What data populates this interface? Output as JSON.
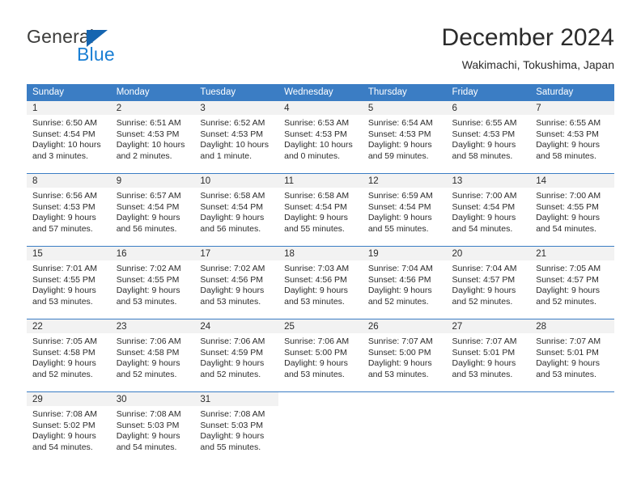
{
  "brand": {
    "name_top": "General",
    "name_bottom": "Blue",
    "triangle_color": "#1565b0",
    "blue_color": "#1a7fd4"
  },
  "header": {
    "title": "December 2024",
    "subtitle": "Wakimachi, Tokushima, Japan"
  },
  "theme": {
    "header_blue": "#3b7dc4",
    "daynum_gray": "#f2f2f2",
    "text": "#2b2b2b"
  },
  "weekday_headers": [
    "Sunday",
    "Monday",
    "Tuesday",
    "Wednesday",
    "Thursday",
    "Friday",
    "Saturday"
  ],
  "weeks": [
    [
      {
        "day": "1",
        "sunrise": "Sunrise: 6:50 AM",
        "sunset": "Sunset: 4:54 PM",
        "daylight1": "Daylight: 10 hours",
        "daylight2": "and 3 minutes."
      },
      {
        "day": "2",
        "sunrise": "Sunrise: 6:51 AM",
        "sunset": "Sunset: 4:53 PM",
        "daylight1": "Daylight: 10 hours",
        "daylight2": "and 2 minutes."
      },
      {
        "day": "3",
        "sunrise": "Sunrise: 6:52 AM",
        "sunset": "Sunset: 4:53 PM",
        "daylight1": "Daylight: 10 hours",
        "daylight2": "and 1 minute."
      },
      {
        "day": "4",
        "sunrise": "Sunrise: 6:53 AM",
        "sunset": "Sunset: 4:53 PM",
        "daylight1": "Daylight: 10 hours",
        "daylight2": "and 0 minutes."
      },
      {
        "day": "5",
        "sunrise": "Sunrise: 6:54 AM",
        "sunset": "Sunset: 4:53 PM",
        "daylight1": "Daylight: 9 hours",
        "daylight2": "and 59 minutes."
      },
      {
        "day": "6",
        "sunrise": "Sunrise: 6:55 AM",
        "sunset": "Sunset: 4:53 PM",
        "daylight1": "Daylight: 9 hours",
        "daylight2": "and 58 minutes."
      },
      {
        "day": "7",
        "sunrise": "Sunrise: 6:55 AM",
        "sunset": "Sunset: 4:53 PM",
        "daylight1": "Daylight: 9 hours",
        "daylight2": "and 58 minutes."
      }
    ],
    [
      {
        "day": "8",
        "sunrise": "Sunrise: 6:56 AM",
        "sunset": "Sunset: 4:53 PM",
        "daylight1": "Daylight: 9 hours",
        "daylight2": "and 57 minutes."
      },
      {
        "day": "9",
        "sunrise": "Sunrise: 6:57 AM",
        "sunset": "Sunset: 4:54 PM",
        "daylight1": "Daylight: 9 hours",
        "daylight2": "and 56 minutes."
      },
      {
        "day": "10",
        "sunrise": "Sunrise: 6:58 AM",
        "sunset": "Sunset: 4:54 PM",
        "daylight1": "Daylight: 9 hours",
        "daylight2": "and 56 minutes."
      },
      {
        "day": "11",
        "sunrise": "Sunrise: 6:58 AM",
        "sunset": "Sunset: 4:54 PM",
        "daylight1": "Daylight: 9 hours",
        "daylight2": "and 55 minutes."
      },
      {
        "day": "12",
        "sunrise": "Sunrise: 6:59 AM",
        "sunset": "Sunset: 4:54 PM",
        "daylight1": "Daylight: 9 hours",
        "daylight2": "and 55 minutes."
      },
      {
        "day": "13",
        "sunrise": "Sunrise: 7:00 AM",
        "sunset": "Sunset: 4:54 PM",
        "daylight1": "Daylight: 9 hours",
        "daylight2": "and 54 minutes."
      },
      {
        "day": "14",
        "sunrise": "Sunrise: 7:00 AM",
        "sunset": "Sunset: 4:55 PM",
        "daylight1": "Daylight: 9 hours",
        "daylight2": "and 54 minutes."
      }
    ],
    [
      {
        "day": "15",
        "sunrise": "Sunrise: 7:01 AM",
        "sunset": "Sunset: 4:55 PM",
        "daylight1": "Daylight: 9 hours",
        "daylight2": "and 53 minutes."
      },
      {
        "day": "16",
        "sunrise": "Sunrise: 7:02 AM",
        "sunset": "Sunset: 4:55 PM",
        "daylight1": "Daylight: 9 hours",
        "daylight2": "and 53 minutes."
      },
      {
        "day": "17",
        "sunrise": "Sunrise: 7:02 AM",
        "sunset": "Sunset: 4:56 PM",
        "daylight1": "Daylight: 9 hours",
        "daylight2": "and 53 minutes."
      },
      {
        "day": "18",
        "sunrise": "Sunrise: 7:03 AM",
        "sunset": "Sunset: 4:56 PM",
        "daylight1": "Daylight: 9 hours",
        "daylight2": "and 53 minutes."
      },
      {
        "day": "19",
        "sunrise": "Sunrise: 7:04 AM",
        "sunset": "Sunset: 4:56 PM",
        "daylight1": "Daylight: 9 hours",
        "daylight2": "and 52 minutes."
      },
      {
        "day": "20",
        "sunrise": "Sunrise: 7:04 AM",
        "sunset": "Sunset: 4:57 PM",
        "daylight1": "Daylight: 9 hours",
        "daylight2": "and 52 minutes."
      },
      {
        "day": "21",
        "sunrise": "Sunrise: 7:05 AM",
        "sunset": "Sunset: 4:57 PM",
        "daylight1": "Daylight: 9 hours",
        "daylight2": "and 52 minutes."
      }
    ],
    [
      {
        "day": "22",
        "sunrise": "Sunrise: 7:05 AM",
        "sunset": "Sunset: 4:58 PM",
        "daylight1": "Daylight: 9 hours",
        "daylight2": "and 52 minutes."
      },
      {
        "day": "23",
        "sunrise": "Sunrise: 7:06 AM",
        "sunset": "Sunset: 4:58 PM",
        "daylight1": "Daylight: 9 hours",
        "daylight2": "and 52 minutes."
      },
      {
        "day": "24",
        "sunrise": "Sunrise: 7:06 AM",
        "sunset": "Sunset: 4:59 PM",
        "daylight1": "Daylight: 9 hours",
        "daylight2": "and 52 minutes."
      },
      {
        "day": "25",
        "sunrise": "Sunrise: 7:06 AM",
        "sunset": "Sunset: 5:00 PM",
        "daylight1": "Daylight: 9 hours",
        "daylight2": "and 53 minutes."
      },
      {
        "day": "26",
        "sunrise": "Sunrise: 7:07 AM",
        "sunset": "Sunset: 5:00 PM",
        "daylight1": "Daylight: 9 hours",
        "daylight2": "and 53 minutes."
      },
      {
        "day": "27",
        "sunrise": "Sunrise: 7:07 AM",
        "sunset": "Sunset: 5:01 PM",
        "daylight1": "Daylight: 9 hours",
        "daylight2": "and 53 minutes."
      },
      {
        "day": "28",
        "sunrise": "Sunrise: 7:07 AM",
        "sunset": "Sunset: 5:01 PM",
        "daylight1": "Daylight: 9 hours",
        "daylight2": "and 53 minutes."
      }
    ],
    [
      {
        "day": "29",
        "sunrise": "Sunrise: 7:08 AM",
        "sunset": "Sunset: 5:02 PM",
        "daylight1": "Daylight: 9 hours",
        "daylight2": "and 54 minutes."
      },
      {
        "day": "30",
        "sunrise": "Sunrise: 7:08 AM",
        "sunset": "Sunset: 5:03 PM",
        "daylight1": "Daylight: 9 hours",
        "daylight2": "and 54 minutes."
      },
      {
        "day": "31",
        "sunrise": "Sunrise: 7:08 AM",
        "sunset": "Sunset: 5:03 PM",
        "daylight1": "Daylight: 9 hours",
        "daylight2": "and 55 minutes."
      },
      {
        "day": "",
        "sunrise": "",
        "sunset": "",
        "daylight1": "",
        "daylight2": ""
      },
      {
        "day": "",
        "sunrise": "",
        "sunset": "",
        "daylight1": "",
        "daylight2": ""
      },
      {
        "day": "",
        "sunrise": "",
        "sunset": "",
        "daylight1": "",
        "daylight2": ""
      },
      {
        "day": "",
        "sunrise": "",
        "sunset": "",
        "daylight1": "",
        "daylight2": ""
      }
    ]
  ]
}
